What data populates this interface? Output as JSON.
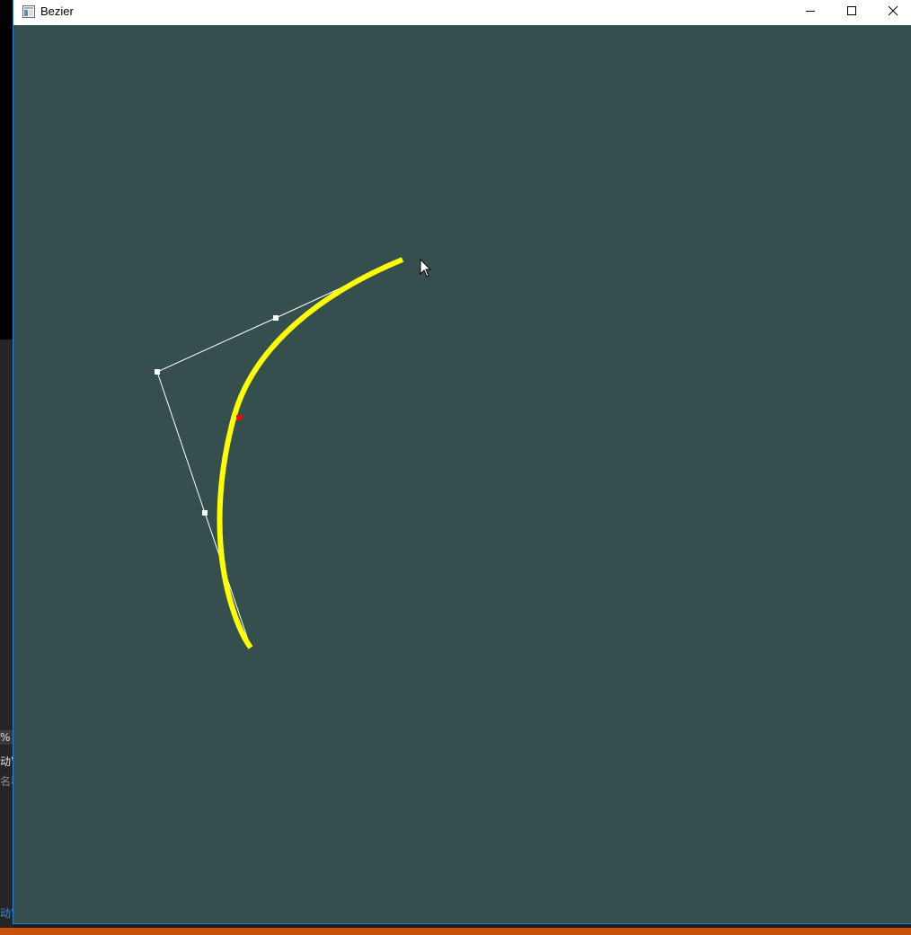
{
  "window": {
    "title": "Bezier"
  },
  "background_app": {
    "fragments": [
      "%",
      "动窗",
      "名称",
      "动窗"
    ]
  },
  "canvas": {
    "background_color": "#354f4f",
    "curve_color": "#ffff00",
    "control_line_color": "#ffffff",
    "control_point_color": "#ffffff",
    "marker_color": "#ff0000"
  },
  "icons": {
    "app": "window-app-icon",
    "minimize": "minimize-icon",
    "maximize": "maximize-icon",
    "close": "close-icon",
    "cursor": "mouse-pointer-icon"
  }
}
